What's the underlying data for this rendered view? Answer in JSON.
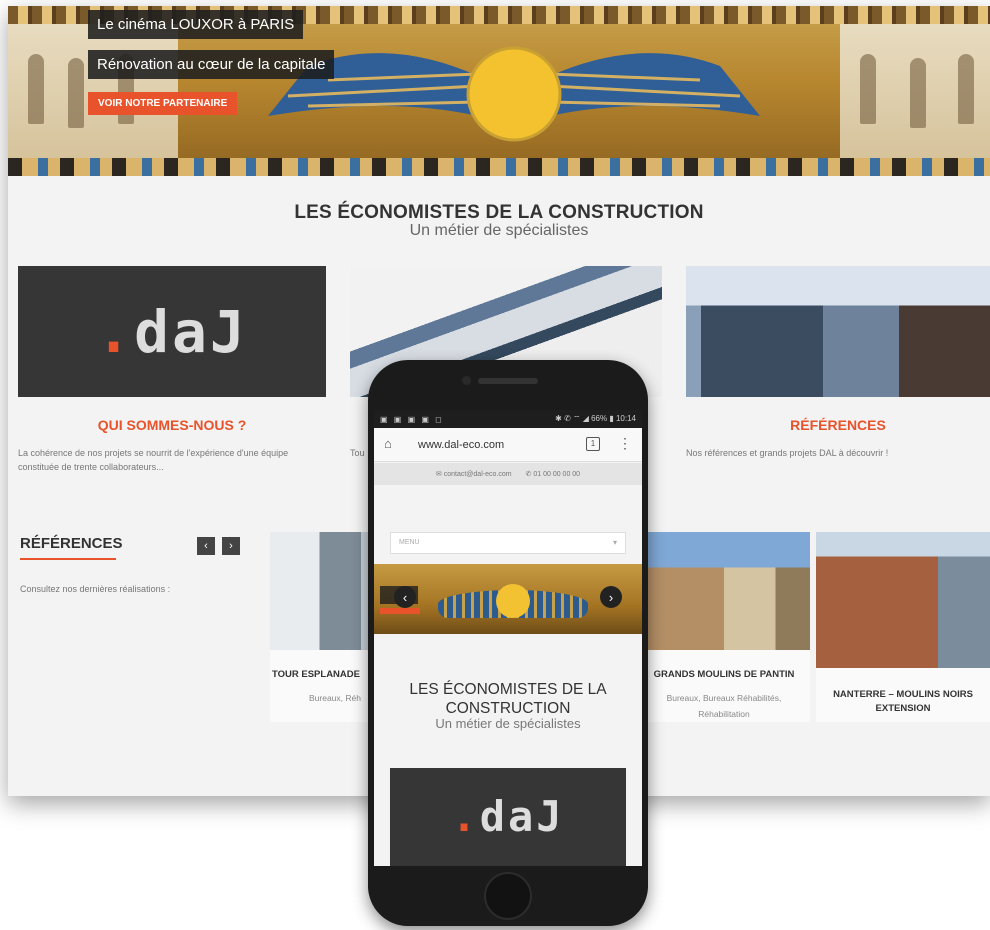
{
  "hero": {
    "caption_line1": "Le cinéma LOUXOR à PARIS",
    "caption_line2": "Rénovation au cœur de la capitale",
    "partner_button": "VOIR NOTRE PARTENAIRE"
  },
  "section": {
    "title": "LES ÉCONOMISTES DE LA CONSTRUCTION",
    "subtitle": "Un métier de spécialistes"
  },
  "logo": {
    "dot": ".",
    "text": "daJ"
  },
  "columns": [
    {
      "title": "QUI SOMMES-NOUS ?",
      "text": "La cohérence de nos projets se nourrit de l'expérience d'une équipe constituée de trente collaborateurs..."
    },
    {
      "title": "",
      "text": "Tou"
    },
    {
      "title": "RÉFÉRENCES",
      "text": "Nos références et grands projets DAL à découvrir !"
    }
  ],
  "references": {
    "heading": "RÉFÉRENCES",
    "prev_label": "‹",
    "next_label": "›",
    "text": "Consultez nos dernières réalisations :",
    "cards": [
      {
        "title": "TOUR ESPLANADE",
        "subtitle": "Bureaux, Réh"
      },
      {
        "title": "GRANDS MOULINS DE PANTIN",
        "subtitle": "Bureaux, Bureaux Réhabilités, Réhabilitation"
      },
      {
        "title": "NANTERRE – MOULINS NOIRS EXTENSION",
        "subtitle": ""
      }
    ]
  },
  "phone": {
    "status_left": "▣ ▣ ▣ ▣ ◻",
    "status_right": "✱ ✆ ⌔ ◢ 66% ▮ 10:14",
    "url": "www.dal-eco.com",
    "tab_count": "1",
    "contact_email": "contact@dal-eco.com",
    "contact_phone": "01 00 00 00 00",
    "menu_label": "MENU",
    "menu_caret": "▾",
    "prev_arrow": "‹",
    "next_arrow": "›",
    "title": "LES ÉCONOMISTES DE LA CONSTRUCTION",
    "subtitle": "Un métier de spécialistes"
  },
  "icons": {
    "home": "home-icon",
    "tabs": "tabs-icon",
    "menu": "more-vert-icon",
    "mail": "mail-icon",
    "phone": "phone-icon"
  },
  "colors": {
    "accent": "#e8532b",
    "dark": "#363636",
    "background": "#f3f3f3"
  }
}
